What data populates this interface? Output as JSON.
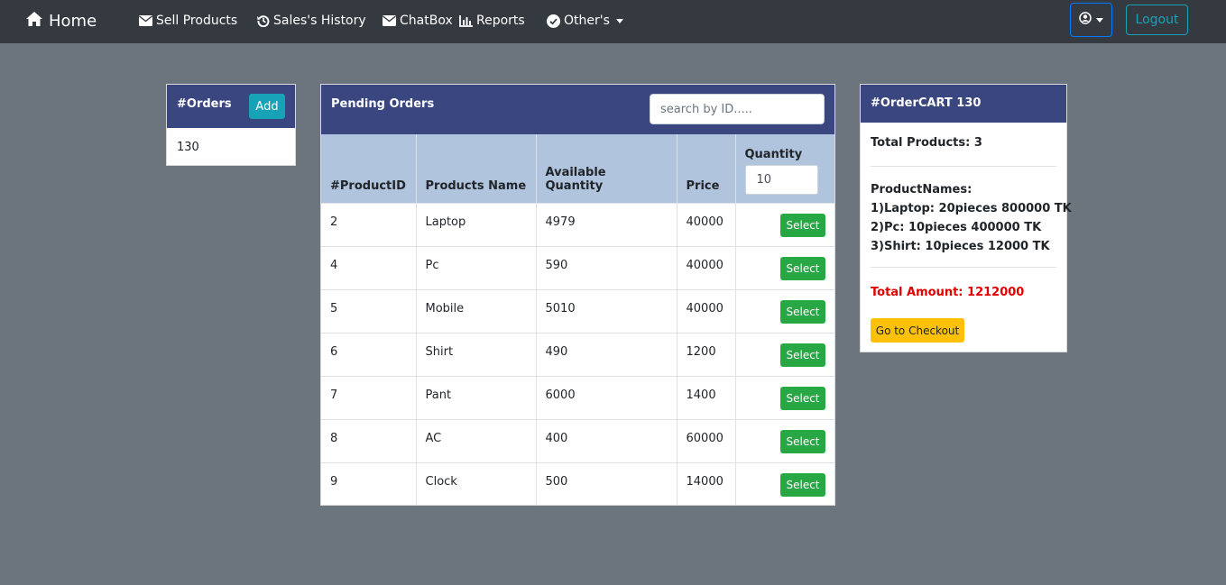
{
  "navbar": {
    "brand": "Home",
    "items": [
      {
        "label": "Sell Products",
        "icon": "envelope-icon"
      },
      {
        "label": "Sales's History",
        "icon": "history-icon"
      },
      {
        "label": "ChatBox",
        "icon": "envelope-icon"
      },
      {
        "label": "Reports",
        "icon": "bar-chart-icon"
      },
      {
        "label": "Other's",
        "icon": "check-circle-icon"
      }
    ],
    "logout": "Logout"
  },
  "orders": {
    "title": "#Orders",
    "add_label": "Add",
    "list": [
      "130"
    ]
  },
  "pending": {
    "title": "Pending Orders",
    "search_placeholder": "search by ID.....",
    "columns": [
      "#ProductID",
      "Products Name",
      "Available Quantity",
      "Price",
      "Quantity"
    ],
    "quantity_value": "10",
    "select_label": "Select",
    "rows": [
      {
        "id": "2",
        "name": "Laptop",
        "qty": "4979",
        "price": "40000"
      },
      {
        "id": "4",
        "name": "Pc",
        "qty": "590",
        "price": "40000"
      },
      {
        "id": "5",
        "name": "Mobile",
        "qty": "5010",
        "price": "40000"
      },
      {
        "id": "6",
        "name": "Shirt",
        "qty": "490",
        "price": "1200"
      },
      {
        "id": "7",
        "name": "Pant",
        "qty": "6000",
        "price": "1400"
      },
      {
        "id": "8",
        "name": "AC",
        "qty": "400",
        "price": "60000"
      },
      {
        "id": "9",
        "name": "Clock",
        "qty": "500",
        "price": "14000"
      }
    ]
  },
  "cart": {
    "title": "#OrderCART 130",
    "total_products": "Total Products: 3",
    "product_names_label": "ProductNames:",
    "products": [
      "1)Laptop: 20pieces 800000 TK",
      "2)Pc: 10pieces 400000 TK",
      "3)Shirt: 10pieces 12000 TK"
    ],
    "total_amount": "Total Amount: 1212000",
    "checkout_label": "Go to Checkout"
  },
  "colors": {
    "background": "#6c757d",
    "navbar": "#343a40",
    "card_header": "#3a4680",
    "table_header": "#b0c4de",
    "select_button": "#28a745",
    "add_button": "#17a2b8",
    "checkout_button": "#ffc107",
    "total_amount": "#e00000"
  }
}
